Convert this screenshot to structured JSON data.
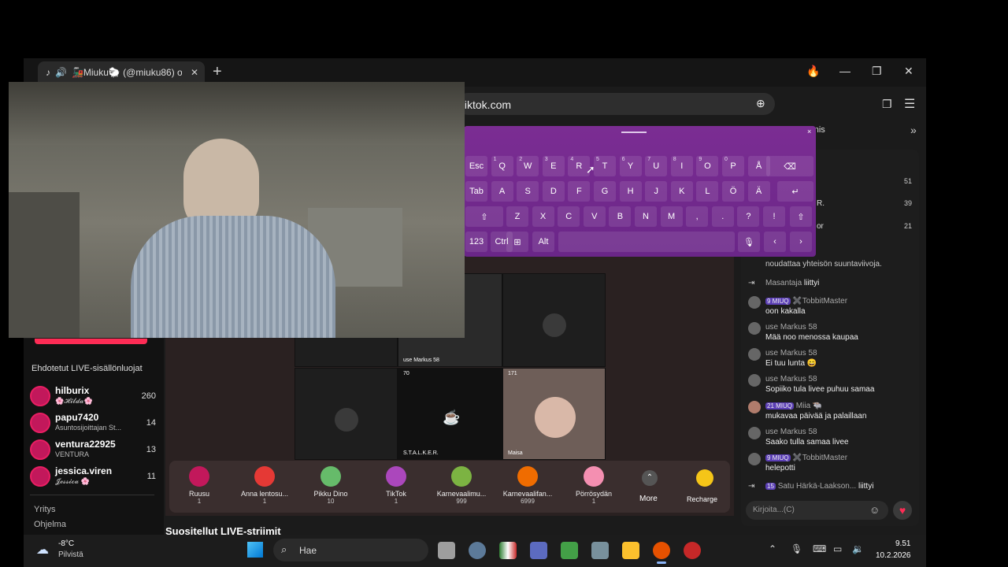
{
  "browser": {
    "tab_title": "🚂Miuku🐑 (@miuku86) o",
    "address": "tiktok.com",
    "bookmark": "Tennis"
  },
  "keyboard": {
    "row1": [
      [
        "Esc",
        ""
      ],
      [
        "Q",
        "1"
      ],
      [
        "W",
        "2"
      ],
      [
        "E",
        "3"
      ],
      [
        "R",
        "4"
      ],
      [
        "T",
        "5"
      ],
      [
        "Y",
        "6"
      ],
      [
        "U",
        "7"
      ],
      [
        "I",
        "8"
      ],
      [
        "O",
        "9"
      ],
      [
        "P",
        "0"
      ],
      [
        "Å",
        ""
      ]
    ],
    "row2": [
      "Tab",
      "A",
      "S",
      "D",
      "F",
      "G",
      "H",
      "J",
      "K",
      "L",
      "Ö",
      "Ä"
    ],
    "row3": [
      "Z",
      "X",
      "C",
      "V",
      "B",
      "N",
      "M",
      ",",
      ".",
      "?",
      "!"
    ],
    "row4": [
      "123",
      "Ctrl",
      "Alt"
    ],
    "close": "×"
  },
  "sidebar": {
    "suggested_heading": "Ehdotetut LIVE-sisällönluojat",
    "creators": [
      {
        "name": "hilburix",
        "sub": "🌸𝓗𝓲𝓵𝓭𝓪🌸",
        "count": "260"
      },
      {
        "name": "papu7420",
        "sub": "Asuntosijoittajan St...",
        "count": "14"
      },
      {
        "name": "ventura22925",
        "sub": "VENTURA",
        "count": "13"
      },
      {
        "name": "jessica.viren",
        "sub": "𝓙𝓮𝓼𝓼𝓲𝓬𝓪 🌸",
        "count": "11"
      }
    ],
    "links": [
      "Yritys",
      "Ohjelma"
    ]
  },
  "stream": {
    "tiles": [
      {
        "label": "use Markus 58",
        "count": ""
      },
      {
        "label": "S.T.A.L.K.E.R.",
        "count": "70"
      },
      {
        "label": "Maisa",
        "count": "171"
      }
    ],
    "recommended": "Suositellut LIVE-striimit"
  },
  "gifts": [
    {
      "name": "Ruusu",
      "price": "1"
    },
    {
      "name": "Anna lentosu...",
      "price": "1"
    },
    {
      "name": "Pikku Dino",
      "price": "10"
    },
    {
      "name": "TikTok",
      "price": "1"
    },
    {
      "name": "Karnevaalimu...",
      "price": "999"
    },
    {
      "name": "Karnevaalifan...",
      "price": "6999"
    },
    {
      "name": "Pörrösydän",
      "price": "1"
    }
  ],
  "gift_more": "More",
  "recharge": "Recharge",
  "ranking": [
    {
      "name": "",
      "count": "51"
    },
    {
      "name": "R.",
      "count": "39"
    },
    {
      "name": "or",
      "count": "21"
    }
  ],
  "chat": {
    "rules": "noudattaa yhteisön suuntaviivoja.",
    "messages": [
      {
        "user": "Masantaja",
        "text": "liittyi",
        "badges": ""
      },
      {
        "user": "✖️TobbitMaster",
        "text": "oon kakalla",
        "badges": "9 MIUQ"
      },
      {
        "user": "use Markus 58",
        "text": "Mää noo menossa kaupaa",
        "badges": ""
      },
      {
        "user": "use Markus 58",
        "text": "Ei tuu lunta 😄",
        "badges": ""
      },
      {
        "user": "use Markus 58",
        "text": "Sopiiko tula livee puhuu samaa",
        "badges": ""
      },
      {
        "user": "Miia 🐃",
        "text": "mukavaa päivää ja palaillaan",
        "badges": "21 MIUQ"
      },
      {
        "user": "use Markus 58",
        "text": "Saako tulla samaa livee",
        "badges": ""
      },
      {
        "user": "✖️TobbitMaster",
        "text": "helepotti",
        "badges": "9 MIUQ"
      },
      {
        "user": "Satu Härkä-Laakson...",
        "text": "liittyi",
        "badges": "15"
      }
    ],
    "input_placeholder": "Kirjoita...(C)"
  },
  "taskbar": {
    "weather_temp": "-8°C",
    "weather_desc": "Pilvistä",
    "search": "Hae",
    "time": "9.51",
    "date": "10.2.2026"
  }
}
